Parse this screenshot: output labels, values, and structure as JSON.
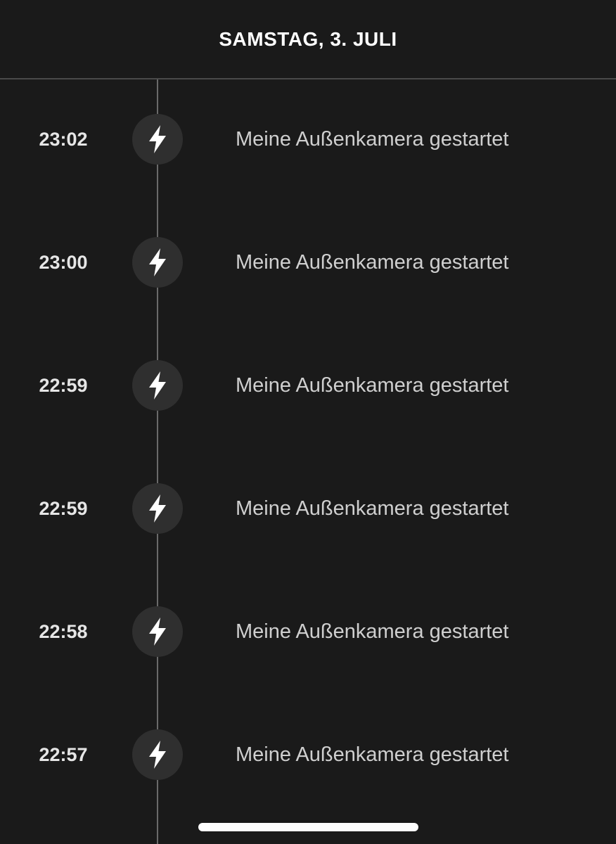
{
  "header": {
    "title": "SAMSTAG, 3. JULI"
  },
  "events": [
    {
      "time": "23:02",
      "text": "Meine Außenkamera gestartet",
      "icon": "lightning-bolt-icon"
    },
    {
      "time": "23:00",
      "text": "Meine Außenkamera gestartet",
      "icon": "lightning-bolt-icon"
    },
    {
      "time": "22:59",
      "text": "Meine Außenkamera gestartet",
      "icon": "lightning-bolt-icon"
    },
    {
      "time": "22:59",
      "text": "Meine Außenkamera gestartet",
      "icon": "lightning-bolt-icon"
    },
    {
      "time": "22:58",
      "text": "Meine Außenkamera gestartet",
      "icon": "lightning-bolt-icon"
    },
    {
      "time": "22:57",
      "text": "Meine Außenkamera gestartet",
      "icon": "lightning-bolt-icon"
    }
  ],
  "colors": {
    "background": "#1a1a1a",
    "icon_circle": "#2f2f2f",
    "timeline": "#6a6a6a",
    "text": "#cfcfcf"
  }
}
